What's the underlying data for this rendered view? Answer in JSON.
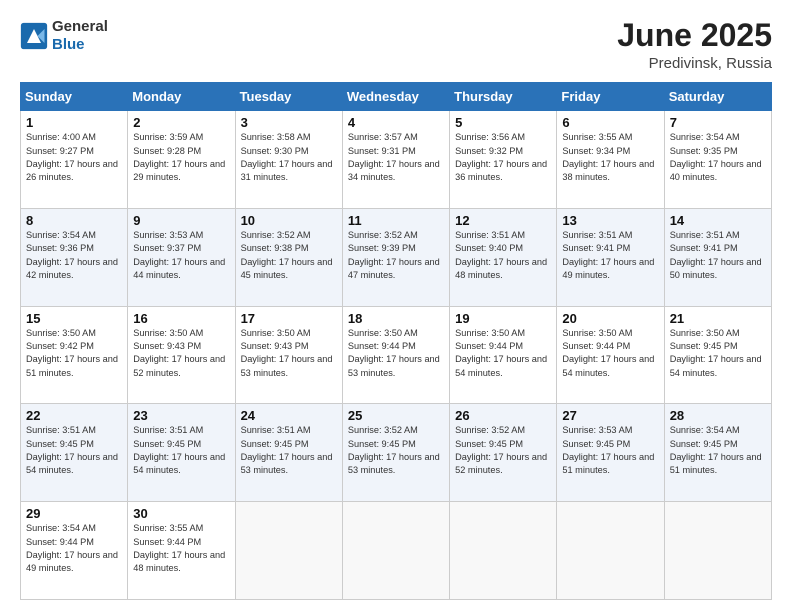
{
  "header": {
    "logo_general": "General",
    "logo_blue": "Blue",
    "title": "June 2025",
    "location": "Predivinsk, Russia"
  },
  "days_of_week": [
    "Sunday",
    "Monday",
    "Tuesday",
    "Wednesday",
    "Thursday",
    "Friday",
    "Saturday"
  ],
  "weeks": [
    [
      {
        "num": "1",
        "sunrise": "Sunrise: 4:00 AM",
        "sunset": "Sunset: 9:27 PM",
        "daylight": "Daylight: 17 hours and 26 minutes."
      },
      {
        "num": "2",
        "sunrise": "Sunrise: 3:59 AM",
        "sunset": "Sunset: 9:28 PM",
        "daylight": "Daylight: 17 hours and 29 minutes."
      },
      {
        "num": "3",
        "sunrise": "Sunrise: 3:58 AM",
        "sunset": "Sunset: 9:30 PM",
        "daylight": "Daylight: 17 hours and 31 minutes."
      },
      {
        "num": "4",
        "sunrise": "Sunrise: 3:57 AM",
        "sunset": "Sunset: 9:31 PM",
        "daylight": "Daylight: 17 hours and 34 minutes."
      },
      {
        "num": "5",
        "sunrise": "Sunrise: 3:56 AM",
        "sunset": "Sunset: 9:32 PM",
        "daylight": "Daylight: 17 hours and 36 minutes."
      },
      {
        "num": "6",
        "sunrise": "Sunrise: 3:55 AM",
        "sunset": "Sunset: 9:34 PM",
        "daylight": "Daylight: 17 hours and 38 minutes."
      },
      {
        "num": "7",
        "sunrise": "Sunrise: 3:54 AM",
        "sunset": "Sunset: 9:35 PM",
        "daylight": "Daylight: 17 hours and 40 minutes."
      }
    ],
    [
      {
        "num": "8",
        "sunrise": "Sunrise: 3:54 AM",
        "sunset": "Sunset: 9:36 PM",
        "daylight": "Daylight: 17 hours and 42 minutes."
      },
      {
        "num": "9",
        "sunrise": "Sunrise: 3:53 AM",
        "sunset": "Sunset: 9:37 PM",
        "daylight": "Daylight: 17 hours and 44 minutes."
      },
      {
        "num": "10",
        "sunrise": "Sunrise: 3:52 AM",
        "sunset": "Sunset: 9:38 PM",
        "daylight": "Daylight: 17 hours and 45 minutes."
      },
      {
        "num": "11",
        "sunrise": "Sunrise: 3:52 AM",
        "sunset": "Sunset: 9:39 PM",
        "daylight": "Daylight: 17 hours and 47 minutes."
      },
      {
        "num": "12",
        "sunrise": "Sunrise: 3:51 AM",
        "sunset": "Sunset: 9:40 PM",
        "daylight": "Daylight: 17 hours and 48 minutes."
      },
      {
        "num": "13",
        "sunrise": "Sunrise: 3:51 AM",
        "sunset": "Sunset: 9:41 PM",
        "daylight": "Daylight: 17 hours and 49 minutes."
      },
      {
        "num": "14",
        "sunrise": "Sunrise: 3:51 AM",
        "sunset": "Sunset: 9:41 PM",
        "daylight": "Daylight: 17 hours and 50 minutes."
      }
    ],
    [
      {
        "num": "15",
        "sunrise": "Sunrise: 3:50 AM",
        "sunset": "Sunset: 9:42 PM",
        "daylight": "Daylight: 17 hours and 51 minutes."
      },
      {
        "num": "16",
        "sunrise": "Sunrise: 3:50 AM",
        "sunset": "Sunset: 9:43 PM",
        "daylight": "Daylight: 17 hours and 52 minutes."
      },
      {
        "num": "17",
        "sunrise": "Sunrise: 3:50 AM",
        "sunset": "Sunset: 9:43 PM",
        "daylight": "Daylight: 17 hours and 53 minutes."
      },
      {
        "num": "18",
        "sunrise": "Sunrise: 3:50 AM",
        "sunset": "Sunset: 9:44 PM",
        "daylight": "Daylight: 17 hours and 53 minutes."
      },
      {
        "num": "19",
        "sunrise": "Sunrise: 3:50 AM",
        "sunset": "Sunset: 9:44 PM",
        "daylight": "Daylight: 17 hours and 54 minutes."
      },
      {
        "num": "20",
        "sunrise": "Sunrise: 3:50 AM",
        "sunset": "Sunset: 9:44 PM",
        "daylight": "Daylight: 17 hours and 54 minutes."
      },
      {
        "num": "21",
        "sunrise": "Sunrise: 3:50 AM",
        "sunset": "Sunset: 9:45 PM",
        "daylight": "Daylight: 17 hours and 54 minutes."
      }
    ],
    [
      {
        "num": "22",
        "sunrise": "Sunrise: 3:51 AM",
        "sunset": "Sunset: 9:45 PM",
        "daylight": "Daylight: 17 hours and 54 minutes."
      },
      {
        "num": "23",
        "sunrise": "Sunrise: 3:51 AM",
        "sunset": "Sunset: 9:45 PM",
        "daylight": "Daylight: 17 hours and 54 minutes."
      },
      {
        "num": "24",
        "sunrise": "Sunrise: 3:51 AM",
        "sunset": "Sunset: 9:45 PM",
        "daylight": "Daylight: 17 hours and 53 minutes."
      },
      {
        "num": "25",
        "sunrise": "Sunrise: 3:52 AM",
        "sunset": "Sunset: 9:45 PM",
        "daylight": "Daylight: 17 hours and 53 minutes."
      },
      {
        "num": "26",
        "sunrise": "Sunrise: 3:52 AM",
        "sunset": "Sunset: 9:45 PM",
        "daylight": "Daylight: 17 hours and 52 minutes."
      },
      {
        "num": "27",
        "sunrise": "Sunrise: 3:53 AM",
        "sunset": "Sunset: 9:45 PM",
        "daylight": "Daylight: 17 hours and 51 minutes."
      },
      {
        "num": "28",
        "sunrise": "Sunrise: 3:54 AM",
        "sunset": "Sunset: 9:45 PM",
        "daylight": "Daylight: 17 hours and 51 minutes."
      }
    ],
    [
      {
        "num": "29",
        "sunrise": "Sunrise: 3:54 AM",
        "sunset": "Sunset: 9:44 PM",
        "daylight": "Daylight: 17 hours and 49 minutes."
      },
      {
        "num": "30",
        "sunrise": "Sunrise: 3:55 AM",
        "sunset": "Sunset: 9:44 PM",
        "daylight": "Daylight: 17 hours and 48 minutes."
      },
      null,
      null,
      null,
      null,
      null
    ]
  ]
}
